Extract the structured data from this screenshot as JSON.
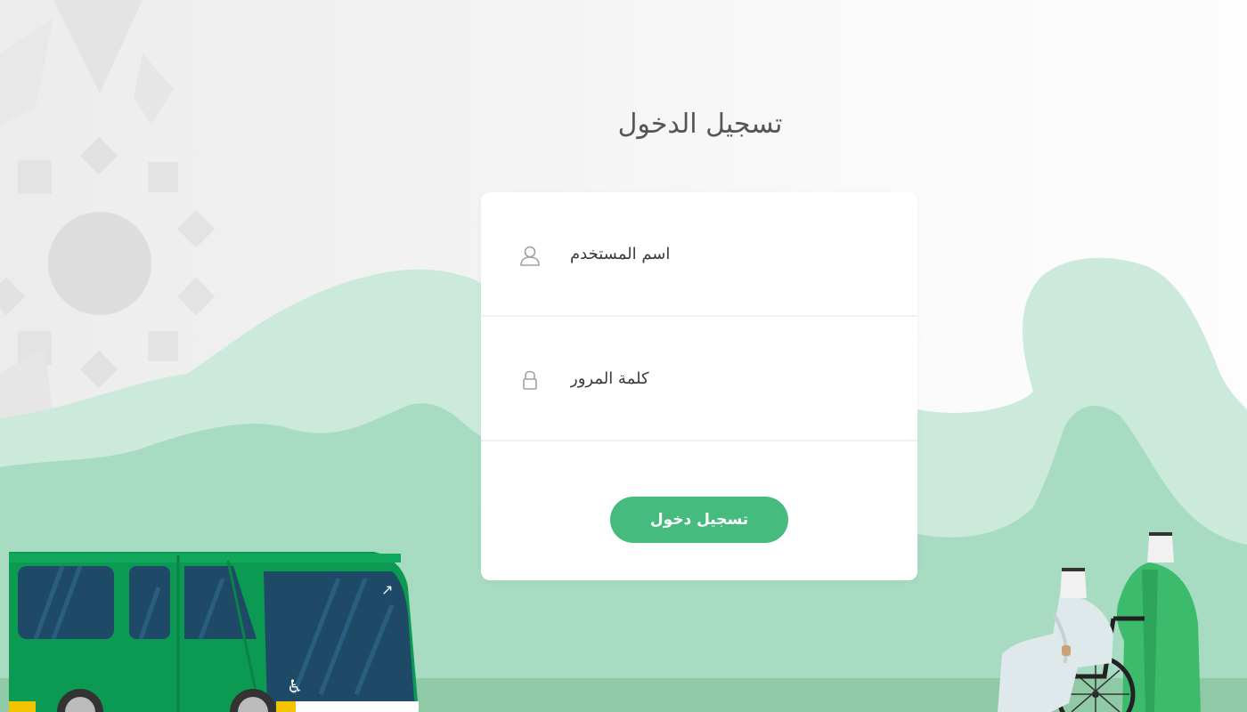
{
  "page": {
    "title": "تسجيل الدخول"
  },
  "form": {
    "username_placeholder": "اسم المستخدم",
    "password_placeholder": "كلمة المرور",
    "submit_label": "تسجيل دخول"
  },
  "icons": {
    "username": "user-icon",
    "password": "lock-icon"
  },
  "colors": {
    "accent": "#45bb7e",
    "hill_light": "#cbeadb",
    "hill_mid": "#a8dcc2",
    "ground": "#8fc9a6",
    "bus_green": "#0c9a52",
    "bus_window": "#1e4a68"
  }
}
